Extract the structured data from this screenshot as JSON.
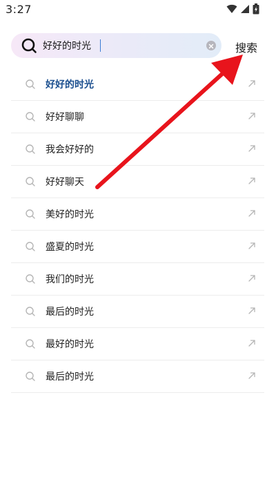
{
  "status_bar": {
    "time": "3:27"
  },
  "search": {
    "query": "好好的时光",
    "button_label": "搜索"
  },
  "suggestions": [
    {
      "label": "好好的时光",
      "highlight": true
    },
    {
      "label": "好好聊聊",
      "highlight": false
    },
    {
      "label": "我会好好的",
      "highlight": false
    },
    {
      "label": "好好聊天",
      "highlight": false
    },
    {
      "label": "美好的时光",
      "highlight": false
    },
    {
      "label": "盛夏的时光",
      "highlight": false
    },
    {
      "label": "我们的时光",
      "highlight": false
    },
    {
      "label": "最后的时光",
      "highlight": false
    },
    {
      "label": "最好的时光",
      "highlight": false
    },
    {
      "label": "最后的时光",
      "highlight": false
    }
  ],
  "colors": {
    "highlight_text": "#1b4f8f",
    "annotation_arrow": "#e8141c"
  }
}
